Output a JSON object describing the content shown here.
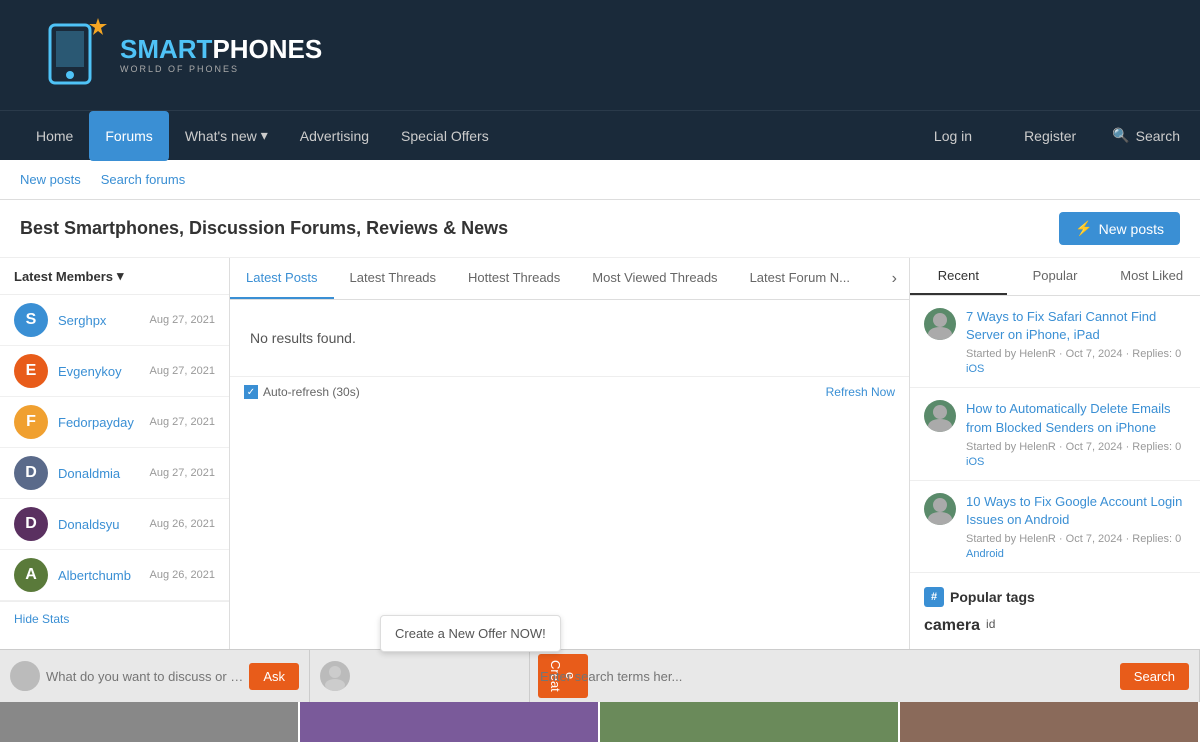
{
  "site": {
    "logo_main": "SMART",
    "logo_main2": "PHONES",
    "logo_sub": "WORLD OF PHONES"
  },
  "nav": {
    "items": [
      {
        "label": "Home",
        "active": false
      },
      {
        "label": "Forums",
        "active": true
      },
      {
        "label": "What's new",
        "active": false,
        "has_arrow": true
      },
      {
        "label": "Advertising",
        "active": false
      },
      {
        "label": "Special Offers",
        "active": false
      }
    ],
    "right": [
      {
        "label": "Log in"
      },
      {
        "label": "Register"
      },
      {
        "label": "Search",
        "is_search": true
      }
    ]
  },
  "sub_nav": {
    "items": [
      {
        "label": "New posts"
      },
      {
        "label": "Search forums"
      }
    ]
  },
  "page": {
    "title": "Best Smartphones, Discussion Forums, Reviews & News",
    "new_posts_label": "New posts"
  },
  "left_panel": {
    "header": "Latest Members",
    "members": [
      {
        "initial": "S",
        "name": "Serghpx",
        "date": "Aug 27, 2021",
        "color": "#3a8fd4"
      },
      {
        "initial": "E",
        "name": "Evgenykoy",
        "date": "Aug 27, 2021",
        "color": "#e85c1a"
      },
      {
        "initial": "F",
        "name": "Fedorpayday",
        "date": "Aug 27, 2021",
        "color": "#f0a030"
      },
      {
        "initial": "D",
        "name": "Donaldmia",
        "date": "Aug 27, 2021",
        "color": "#5a6a8a"
      },
      {
        "initial": "D",
        "name": "Donaldsyu",
        "date": "Aug 26, 2021",
        "color": "#5a3060"
      },
      {
        "initial": "A",
        "name": "Albertchumb",
        "date": "Aug 26, 2021",
        "color": "#5a7a3a"
      }
    ],
    "hide_stats": "Hide Stats"
  },
  "tabs": {
    "items": [
      {
        "label": "Latest Posts",
        "active": true
      },
      {
        "label": "Latest Threads",
        "active": false
      },
      {
        "label": "Hottest Threads",
        "active": false
      },
      {
        "label": "Most Viewed Threads",
        "active": false
      },
      {
        "label": "Latest Forum N...",
        "active": false
      }
    ]
  },
  "center": {
    "no_results": "No results found.",
    "auto_refresh": "Auto-refresh (30s)",
    "refresh_now": "Refresh Now"
  },
  "right_panel": {
    "tabs": [
      {
        "label": "Recent",
        "active": true
      },
      {
        "label": "Popular",
        "active": false
      },
      {
        "label": "Most Liked",
        "active": false
      }
    ],
    "threads": [
      {
        "title": "7 Ways to Fix Safari Cannot Find Server on iPhone, iPad",
        "meta": "Started by HelenR · Oct 7, 2024 · Replies: 0",
        "tag": "iOS"
      },
      {
        "title": "How to Automatically Delete Emails from Blocked Senders on iPhone",
        "meta": "Started by HelenR · Oct 7, 2024 · Replies: 0",
        "tag": "iOS"
      },
      {
        "title": "10 Ways to Fix Google Account Login Issues on Android",
        "meta": "Started by HelenR · Oct 7, 2024 · Replies: 0",
        "tag": "Android"
      }
    ],
    "popular_tags_label": "Popular tags",
    "tags": [
      {
        "label": "camera",
        "size": "large"
      },
      {
        "label": "id",
        "size": "normal"
      }
    ]
  },
  "bottom_bar": {
    "input1_placeholder": "What do you want to discuss or know ab...",
    "input1_btn": "Ask",
    "tooltip": "Create a New Offer NOW!",
    "input2_btn": "Creat\ne",
    "input3_placeholder": "Enter search terms her...",
    "input3_btn": "Search"
  }
}
